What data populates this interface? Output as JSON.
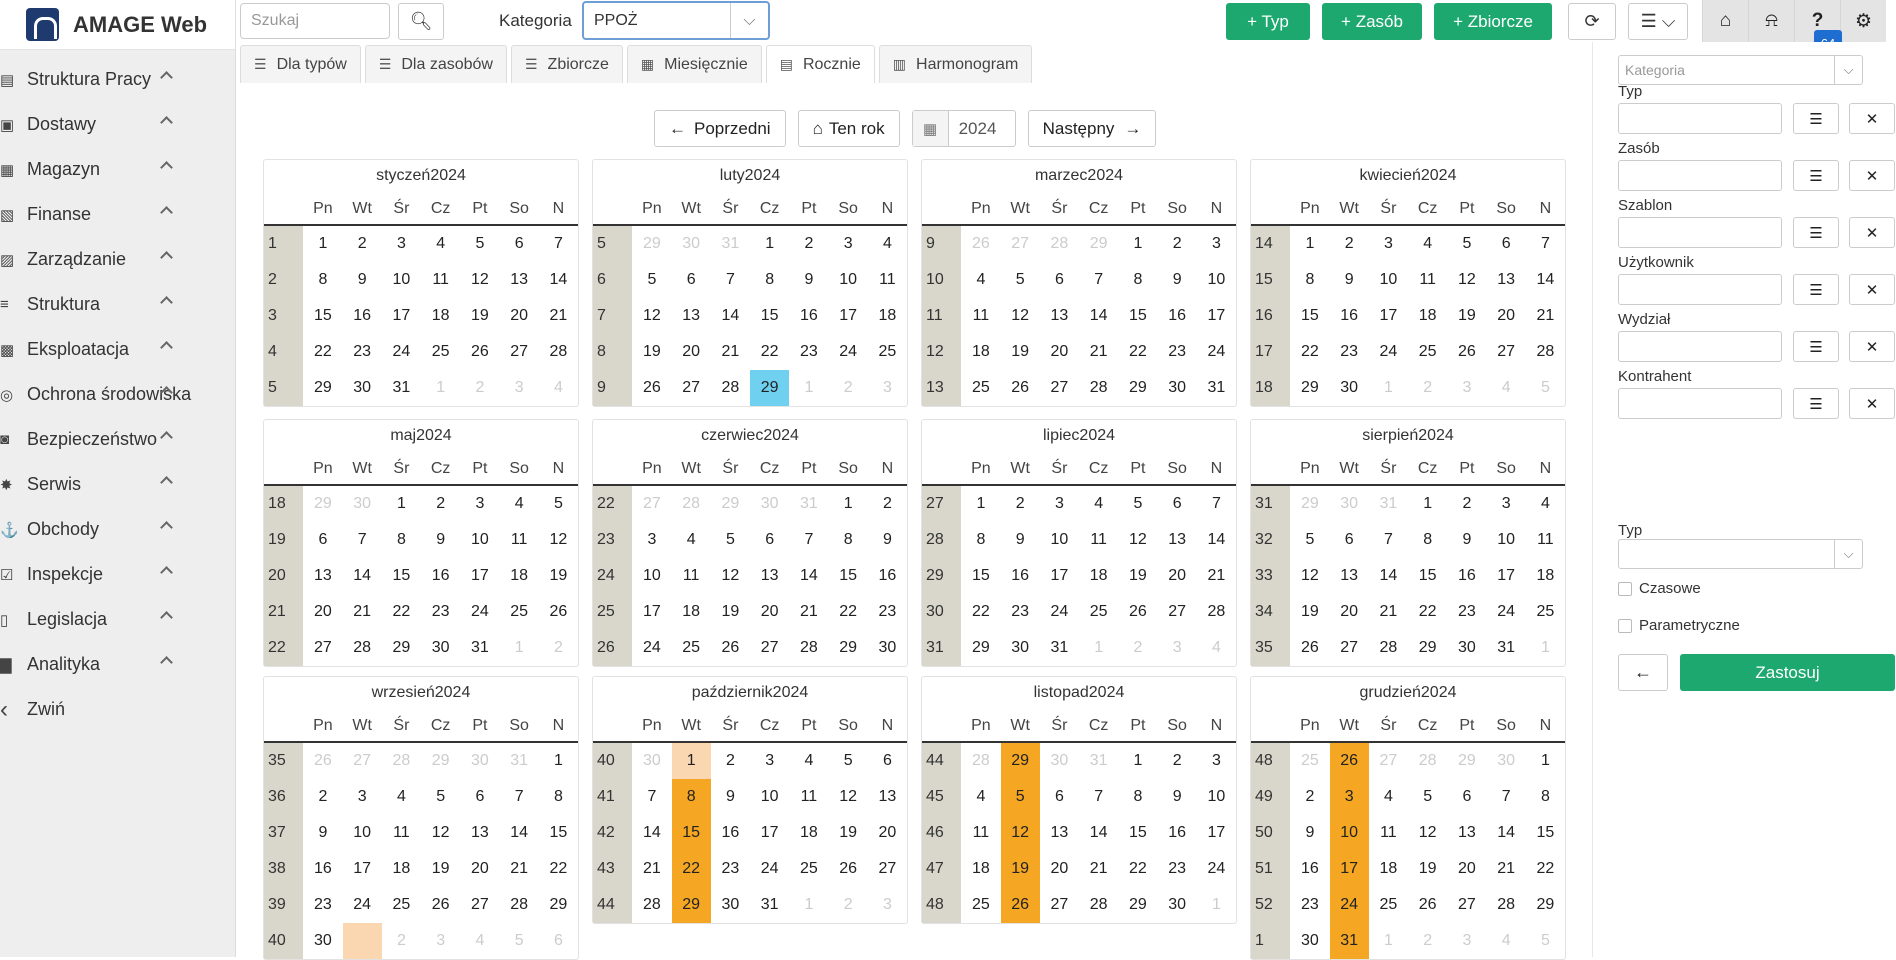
{
  "app": {
    "name": "AMAGE Web"
  },
  "sidebar": {
    "items": [
      {
        "label": "Struktura Pracy",
        "icon": "sitemap-icon"
      },
      {
        "label": "Dostawy",
        "icon": "truck-icon"
      },
      {
        "label": "Magazyn",
        "icon": "warehouse-icon"
      },
      {
        "label": "Finanse",
        "icon": "money-icon"
      },
      {
        "label": "Zarządzanie",
        "icon": "briefcase-icon"
      },
      {
        "label": "Struktura",
        "icon": "layers-icon"
      },
      {
        "label": "Eksploatacja",
        "icon": "machine-icon"
      },
      {
        "label": "Ochrona środowiska",
        "icon": "globe-icon"
      },
      {
        "label": "Bezpieczeństwo",
        "icon": "user-shield-icon"
      },
      {
        "label": "Serwis",
        "icon": "bug-icon"
      },
      {
        "label": "Obchody",
        "icon": "walk-icon"
      },
      {
        "label": "Inspekcje",
        "icon": "check-square-icon"
      },
      {
        "label": "Legislacja",
        "icon": "book-icon"
      },
      {
        "label": "Analityka",
        "icon": "chart-icon"
      },
      {
        "label": "Zwiń",
        "icon": "chevron-left-icon"
      }
    ]
  },
  "topbar": {
    "search_placeholder": "Szukaj",
    "kategoria_label": "Kategoria",
    "kategoria_value": "PPOŻ",
    "btn_typ": "+ Typ",
    "btn_zasob": "+ Zasób",
    "btn_zbiorcze": "+ Zbiorcze",
    "help_badge": "64"
  },
  "tabs": [
    {
      "label": "Dla typów",
      "icon": "list-icon"
    },
    {
      "label": "Dla zasobów",
      "icon": "list-icon"
    },
    {
      "label": "Zbiorcze",
      "icon": "list-icon"
    },
    {
      "label": "Miesięcznie",
      "icon": "calendar-grid-icon"
    },
    {
      "label": "Rocznie",
      "icon": "calendar-icon"
    },
    {
      "label": "Harmonogram",
      "icon": "calendar-clock-icon"
    }
  ],
  "nav": {
    "prev": "Poprzedni",
    "this_year": "Ten rok",
    "year": "2024",
    "next": "Następny"
  },
  "weekdays": [
    "Pn",
    "Wt",
    "Śr",
    "Cz",
    "Pt",
    "So",
    "N"
  ],
  "months": [
    {
      "title": "styczeń2024",
      "weeks": [
        [
          "1",
          "1",
          "2",
          "3",
          "4",
          "5",
          "6",
          "7"
        ],
        [
          "2",
          "8",
          "9",
          "10",
          "11",
          "12",
          "13",
          "14"
        ],
        [
          "3",
          "15",
          "16",
          "17",
          "18",
          "19",
          "20",
          "21"
        ],
        [
          "4",
          "22",
          "23",
          "24",
          "25",
          "26",
          "27",
          "28"
        ],
        [
          "5",
          "29",
          "30",
          "31",
          "1",
          "2",
          "3",
          "4"
        ]
      ]
    },
    {
      "title": "luty2024",
      "weeks": [
        [
          "5",
          "29",
          "30",
          "31",
          "1",
          "2",
          "3",
          "4"
        ],
        [
          "6",
          "5",
          "6",
          "7",
          "8",
          "9",
          "10",
          "11"
        ],
        [
          "7",
          "12",
          "13",
          "14",
          "15",
          "16",
          "17",
          "18"
        ],
        [
          "8",
          "19",
          "20",
          "21",
          "22",
          "23",
          "24",
          "25"
        ],
        [
          "9",
          "26",
          "27",
          "28",
          "29",
          "1",
          "2",
          "3"
        ]
      ]
    },
    {
      "title": "marzec2024",
      "weeks": [
        [
          "9",
          "26",
          "27",
          "28",
          "29",
          "1",
          "2",
          "3"
        ],
        [
          "10",
          "4",
          "5",
          "6",
          "7",
          "8",
          "9",
          "10"
        ],
        [
          "11",
          "11",
          "12",
          "13",
          "14",
          "15",
          "16",
          "17"
        ],
        [
          "12",
          "18",
          "19",
          "20",
          "21",
          "22",
          "23",
          "24"
        ],
        [
          "13",
          "25",
          "26",
          "27",
          "28",
          "29",
          "30",
          "31"
        ]
      ]
    },
    {
      "title": "kwiecień2024",
      "weeks": [
        [
          "14",
          "1",
          "2",
          "3",
          "4",
          "5",
          "6",
          "7"
        ],
        [
          "15",
          "8",
          "9",
          "10",
          "11",
          "12",
          "13",
          "14"
        ],
        [
          "16",
          "15",
          "16",
          "17",
          "18",
          "19",
          "20",
          "21"
        ],
        [
          "17",
          "22",
          "23",
          "24",
          "25",
          "26",
          "27",
          "28"
        ],
        [
          "18",
          "29",
          "30",
          "1",
          "2",
          "3",
          "4",
          "5"
        ]
      ]
    },
    {
      "title": "maj2024",
      "weeks": [
        [
          "18",
          "29",
          "30",
          "1",
          "2",
          "3",
          "4",
          "5"
        ],
        [
          "19",
          "6",
          "7",
          "8",
          "9",
          "10",
          "11",
          "12"
        ],
        [
          "20",
          "13",
          "14",
          "15",
          "16",
          "17",
          "18",
          "19"
        ],
        [
          "21",
          "20",
          "21",
          "22",
          "23",
          "24",
          "25",
          "26"
        ],
        [
          "22",
          "27",
          "28",
          "29",
          "30",
          "31",
          "1",
          "2"
        ]
      ]
    },
    {
      "title": "czerwiec2024",
      "weeks": [
        [
          "22",
          "27",
          "28",
          "29",
          "30",
          "31",
          "1",
          "2"
        ],
        [
          "23",
          "3",
          "4",
          "5",
          "6",
          "7",
          "8",
          "9"
        ],
        [
          "24",
          "10",
          "11",
          "12",
          "13",
          "14",
          "15",
          "16"
        ],
        [
          "25",
          "17",
          "18",
          "19",
          "20",
          "21",
          "22",
          "23"
        ],
        [
          "26",
          "24",
          "25",
          "26",
          "27",
          "28",
          "29",
          "30"
        ]
      ]
    },
    {
      "title": "lipiec2024",
      "weeks": [
        [
          "27",
          "1",
          "2",
          "3",
          "4",
          "5",
          "6",
          "7"
        ],
        [
          "28",
          "8",
          "9",
          "10",
          "11",
          "12",
          "13",
          "14"
        ],
        [
          "29",
          "15",
          "16",
          "17",
          "18",
          "19",
          "20",
          "21"
        ],
        [
          "30",
          "22",
          "23",
          "24",
          "25",
          "26",
          "27",
          "28"
        ],
        [
          "31",
          "29",
          "30",
          "31",
          "1",
          "2",
          "3",
          "4"
        ]
      ]
    },
    {
      "title": "sierpień2024",
      "weeks": [
        [
          "31",
          "29",
          "30",
          "31",
          "1",
          "2",
          "3",
          "4"
        ],
        [
          "32",
          "5",
          "6",
          "7",
          "8",
          "9",
          "10",
          "11"
        ],
        [
          "33",
          "12",
          "13",
          "14",
          "15",
          "16",
          "17",
          "18"
        ],
        [
          "34",
          "19",
          "20",
          "21",
          "22",
          "23",
          "24",
          "25"
        ],
        [
          "35",
          "26",
          "27",
          "28",
          "29",
          "30",
          "31",
          "1"
        ]
      ]
    },
    {
      "title": "wrzesień2024",
      "weeks": [
        [
          "35",
          "26",
          "27",
          "28",
          "29",
          "30",
          "31",
          "1"
        ],
        [
          "36",
          "2",
          "3",
          "4",
          "5",
          "6",
          "7",
          "8"
        ],
        [
          "37",
          "9",
          "10",
          "11",
          "12",
          "13",
          "14",
          "15"
        ],
        [
          "38",
          "16",
          "17",
          "18",
          "19",
          "20",
          "21",
          "22"
        ],
        [
          "39",
          "23",
          "24",
          "25",
          "26",
          "27",
          "28",
          "29"
        ],
        [
          "40",
          "30",
          "",
          "2",
          "3",
          "4",
          "5",
          "6"
        ]
      ]
    },
    {
      "title": "październik2024",
      "weeks": [
        [
          "40",
          "30",
          "1",
          "2",
          "3",
          "4",
          "5",
          "6"
        ],
        [
          "41",
          "7",
          "8",
          "9",
          "10",
          "11",
          "12",
          "13"
        ],
        [
          "42",
          "14",
          "15",
          "16",
          "17",
          "18",
          "19",
          "20"
        ],
        [
          "43",
          "21",
          "22",
          "23",
          "24",
          "25",
          "26",
          "27"
        ],
        [
          "44",
          "28",
          "29",
          "30",
          "31",
          "1",
          "2",
          "3"
        ]
      ]
    },
    {
      "title": "listopad2024",
      "weeks": [
        [
          "44",
          "28",
          "29",
          "30",
          "31",
          "1",
          "2",
          "3"
        ],
        [
          "45",
          "4",
          "5",
          "6",
          "7",
          "8",
          "9",
          "10"
        ],
        [
          "46",
          "11",
          "12",
          "13",
          "14",
          "15",
          "16",
          "17"
        ],
        [
          "47",
          "18",
          "19",
          "20",
          "21",
          "22",
          "23",
          "24"
        ],
        [
          "48",
          "25",
          "26",
          "27",
          "28",
          "29",
          "30",
          "1"
        ]
      ]
    },
    {
      "title": "grudzień2024",
      "weeks": [
        [
          "48",
          "25",
          "26",
          "27",
          "28",
          "29",
          "30",
          "1"
        ],
        [
          "49",
          "2",
          "3",
          "4",
          "5",
          "6",
          "7",
          "8"
        ],
        [
          "50",
          "9",
          "10",
          "11",
          "12",
          "13",
          "14",
          "15"
        ],
        [
          "51",
          "16",
          "17",
          "18",
          "19",
          "20",
          "21",
          "22"
        ],
        [
          "52",
          "23",
          "24",
          "25",
          "26",
          "27",
          "28",
          "29"
        ],
        [
          "1",
          "30",
          "31",
          "1",
          "2",
          "3",
          "4",
          "5"
        ]
      ]
    }
  ],
  "right_panel": {
    "kategoria_placeholder": "Kategoria",
    "fields": [
      "Typ",
      "Zasób",
      "Szablon",
      "Użytkownik",
      "Wydział",
      "Kontrahent"
    ],
    "typ_select_label": "Typ",
    "checkbox_czasowe": "Czasowe",
    "checkbox_parametryczne": "Parametryczne",
    "apply": "Zastosuj"
  },
  "colors": {
    "accent": "#1da870",
    "today": "#6fd0f0",
    "event": "#f5a623",
    "event_light": "#fad7b0",
    "week_col": "#d9d7cb"
  }
}
